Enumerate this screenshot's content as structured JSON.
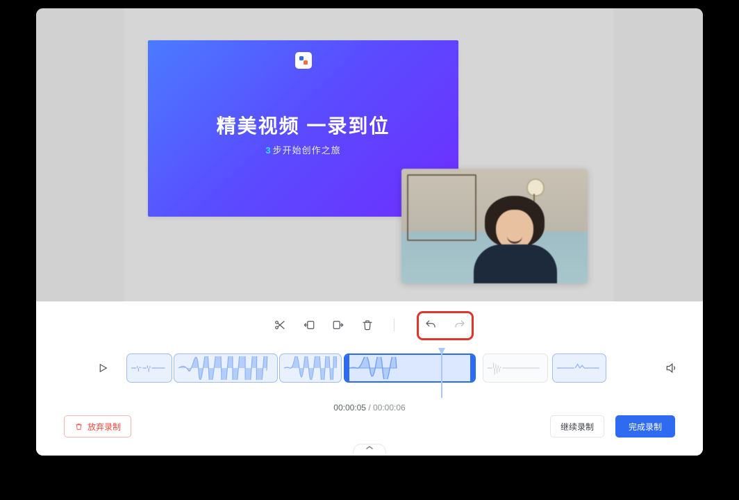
{
  "slide": {
    "title": "精美视频  一录到位",
    "sub_lead": "3",
    "sub_rest": "步开始创作之旅"
  },
  "toolbar": {
    "cut": "cut",
    "trim_start": "trim-start",
    "trim_end": "trim-end",
    "delete": "delete",
    "undo": "undo",
    "redo": "redo"
  },
  "timeline": {
    "play": "play",
    "volume": "volume",
    "current": "00:00:05",
    "sep": " /  ",
    "total": "00:00:06"
  },
  "footer": {
    "discard": "放弃录制",
    "continue": "继续录制",
    "finish": "完成录制"
  }
}
